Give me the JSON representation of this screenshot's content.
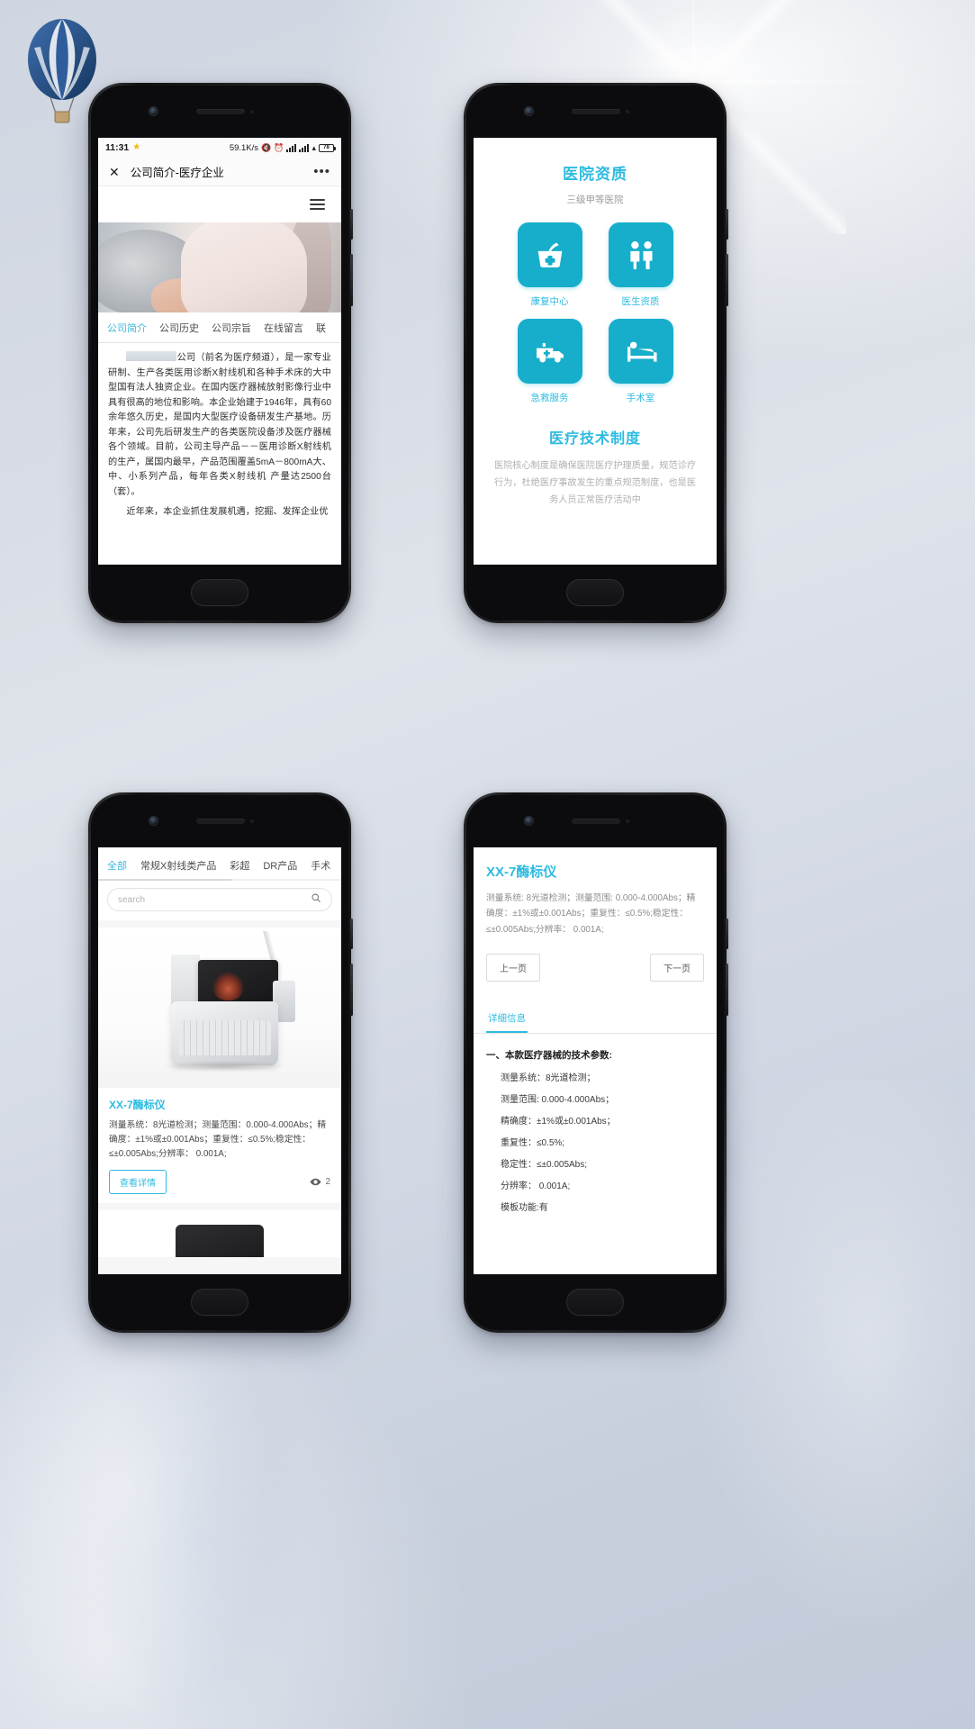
{
  "logo": {
    "name": "hot-air-balloon-logo"
  },
  "phone1": {
    "status": {
      "time": "11:31",
      "star": "★",
      "speed": "59.1K/s",
      "mute_icon": "mute-icon",
      "alarm_icon": "alarm-icon",
      "signal_icon": "signal-bars-icon",
      "wifi_icon": "wifi-icon",
      "battery": "78"
    },
    "wechat_bar": {
      "close": "✕",
      "title": "公司简介-医疗企业",
      "more": "•••"
    },
    "menu_icon": "hamburger-menu-icon",
    "hero_alt": "doctor-photo",
    "tabs": [
      {
        "label": "公司简介",
        "active": true
      },
      {
        "label": "公司历史",
        "active": false
      },
      {
        "label": "公司宗旨",
        "active": false
      },
      {
        "label": "在线留言",
        "active": false
      },
      {
        "label": "联",
        "active": false
      }
    ],
    "article": {
      "p1_prefix": "公司（前名为医疗频道），是一家专业研制、生产各类医用诊断X射线机和各种手术床的大中型国有法人独资企业。在国内医疗器械放射影像行业中具有很高的地位和影响。本企业始建于1946年，具有60余年悠久历史，是国内大型医疗设备研发生产基地。历年来，公司先后研发生产的各类医院设备涉及医疗器械各个领域。目前，公司主导产品－－医用诊断X射线机的生产，属国内最早，产品范围覆盖5mA－800mA大、中、小系列产品，每年各类X射线机 产量达2500台（套）。",
      "p2": "近年来，本企业抓住发展机遇，挖掘、发挥企业优"
    }
  },
  "phone2": {
    "title": "医院资质",
    "subtitle": "三级甲等医院",
    "tiles": [
      {
        "label": "康复中心",
        "icon": "first-aid-basket-icon"
      },
      {
        "label": "医生资质",
        "icon": "doctor-people-icon"
      },
      {
        "label": "急救服务",
        "icon": "ambulance-icon"
      },
      {
        "label": "手术室",
        "icon": "hospital-bed-icon"
      }
    ],
    "section_title": "医疗技术制度",
    "section_body": "医院核心制度是确保医院医疗护理质量，规范诊疗行为，杜绝医疗事故发生的重点规范制度，也是医务人员正常医疗活动中"
  },
  "phone3": {
    "tabs": [
      {
        "label": "全部",
        "active": true
      },
      {
        "label": "常规X射线类产品",
        "active": false
      },
      {
        "label": "彩超",
        "active": false
      },
      {
        "label": "DR产品",
        "active": false
      },
      {
        "label": "手术",
        "active": false
      }
    ],
    "search": {
      "placeholder": "search",
      "icon": "search-icon"
    },
    "card": {
      "image_alt": "ultrasound-machine-photo",
      "title": "XX-7酶标仪",
      "desc": "测量系统：8光道检测；测量范围：0.000-4.000Abs；精确度：±1%或±0.001Abs；重复性：≤0.5%;稳定性：≤±0.005Abs;分辨率：   0.001A;",
      "detail_button": "查看详情",
      "views_icon": "eye-icon",
      "views": "2"
    }
  },
  "phone4": {
    "title": "XX-7酶标仪",
    "desc": "测量系统: 8光道检测；测量范围: 0.000-4.000Abs；精确度：±1%或±0.001Abs；重复性：≤0.5%;稳定性：≤±0.005Abs;分辨率：   0.001A;",
    "prev_button": "上一页",
    "next_button": "下一页",
    "tab_label": "详细信息",
    "section_title": "一、本款医疗器械的技术参数:",
    "params": [
      "测量系统：8光道检测；",
      "测量范围: 0.000-4.000Abs；",
      "精确度：±1%或±0.001Abs；",
      "重复性：≤0.5%;",
      "稳定性：≤±0.005Abs;",
      "分辨率：   0.001A;",
      "模板功能:有"
    ]
  },
  "colors": {
    "accent": "#2ebbe0",
    "tile": "#17aecb",
    "text": "#333333"
  }
}
